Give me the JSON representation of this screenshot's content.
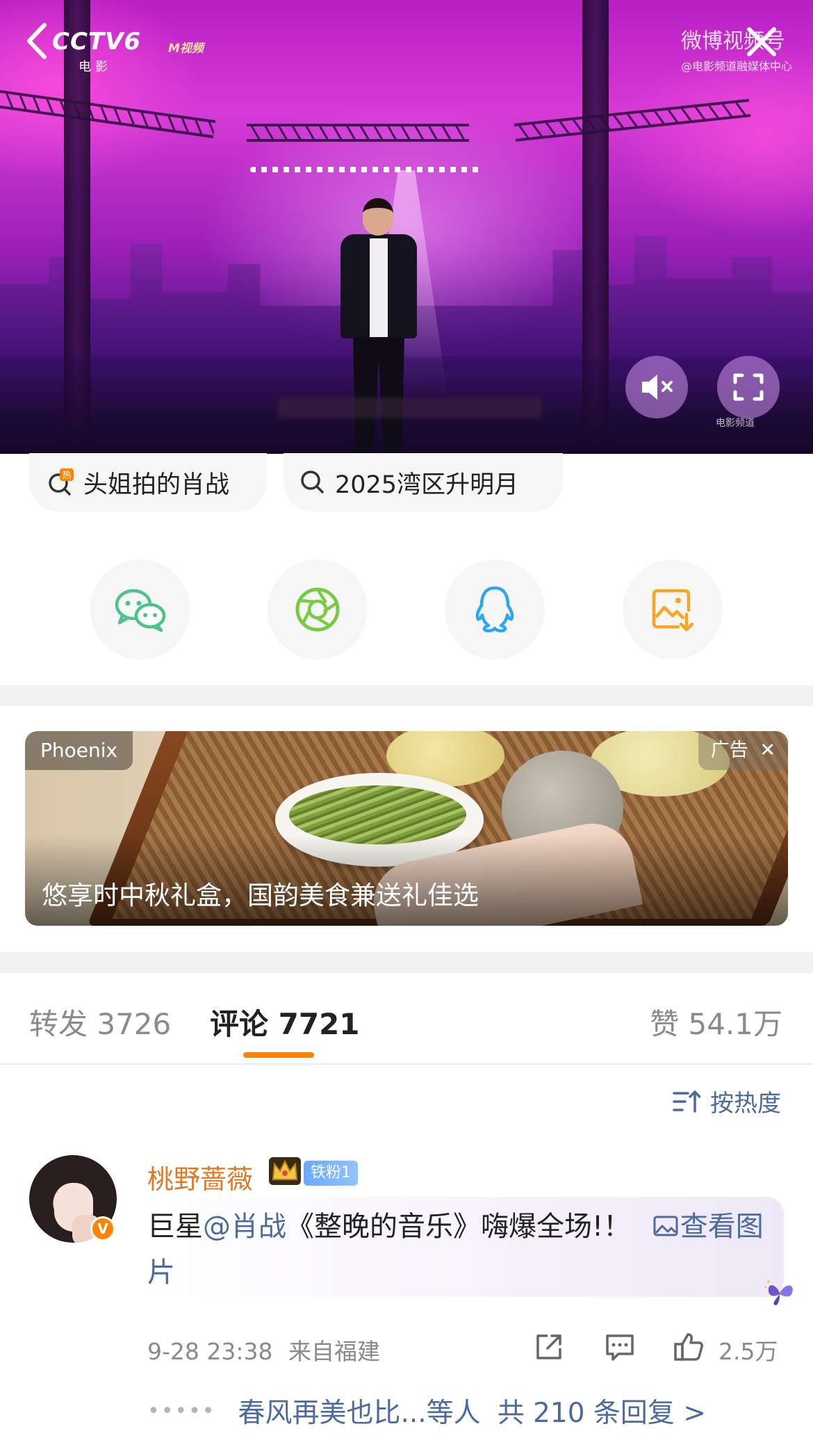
{
  "video": {
    "channel_logo": "CCTV6",
    "channel_sub": "电影",
    "partner_logo": "M视频",
    "source_watermark": "微博视频号",
    "source_sub": "@电影频道融媒体中心",
    "corner_logo": "电影频道",
    "controls": {
      "back": "back-arrow-icon",
      "close": "close-x-icon",
      "mute": "speaker-muted-icon",
      "fullscreen": "fullscreen-icon"
    }
  },
  "topics": [
    {
      "icon": "hot-search-icon",
      "label": "头姐拍的肖战"
    },
    {
      "icon": "search-icon",
      "label": "2025湾区升明月"
    }
  ],
  "share": [
    {
      "name": "wechat",
      "icon": "wechat-icon",
      "color": "#4cc38a"
    },
    {
      "name": "moments",
      "icon": "moments-aperture-icon",
      "color": "#7ac943"
    },
    {
      "name": "qq",
      "icon": "qq-penguin-icon",
      "color": "#2aa6f2"
    },
    {
      "name": "save-image",
      "icon": "save-image-icon",
      "color": "#f5a623"
    }
  ],
  "ad": {
    "brand": "Phoenix",
    "tag": "广告",
    "title": "悠享时中秋礼盒，国韵美食兼送礼佳选"
  },
  "tabs": {
    "repost": "转发 3726",
    "comment": "评论 7721",
    "like": "赞 54.1万",
    "active": "comment",
    "accent": "#ff8200"
  },
  "sort": {
    "label": "按热度"
  },
  "comment": {
    "username": "桃野蔷薇",
    "fan_badge": "铁粉1",
    "verified": "V",
    "text_prefix": "巨星",
    "mention": "@肖战",
    "text_rest": "《整晚的音乐》嗨爆全场!！",
    "view_image": "查看图片",
    "time": "9-28 23:38",
    "location": "来自福建",
    "likes": "2.5万",
    "reply_preview": "春风再美也比...等人",
    "reply_total": "共 210 条回复 >",
    "link_color": "#4a6aa0",
    "name_color": "#e07a26"
  }
}
